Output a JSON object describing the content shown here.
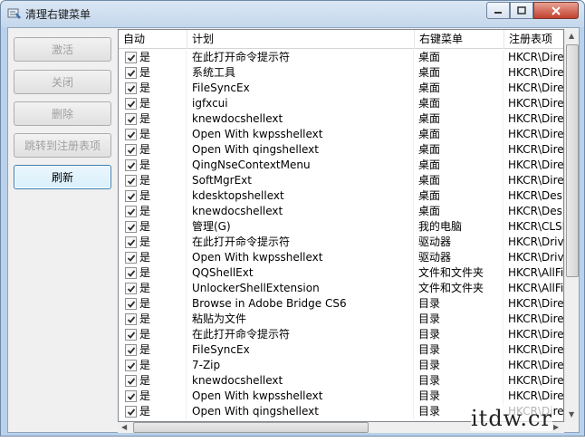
{
  "window": {
    "title": "清理右键菜单"
  },
  "buttons": {
    "activate": "激活",
    "close": "关闭",
    "delete": "删除",
    "jump": "跳转到注册表项",
    "refresh": "刷新"
  },
  "table": {
    "columns": [
      "自动",
      "计划",
      "右键菜单",
      "注册表项"
    ],
    "rows": [
      {
        "auto": "是",
        "plan": "在此打开命令提示符",
        "menu": "桌面",
        "reg": "HKCR\\Directo"
      },
      {
        "auto": "是",
        "plan": "系统工具",
        "menu": "桌面",
        "reg": "HKCR\\Directo"
      },
      {
        "auto": "是",
        "plan": " FileSyncEx",
        "menu": "桌面",
        "reg": "HKCR\\Directo"
      },
      {
        "auto": "是",
        "plan": "igfxcui",
        "menu": "桌面",
        "reg": "HKCR\\Directo"
      },
      {
        "auto": "是",
        "plan": "knewdocshellext",
        "menu": "桌面",
        "reg": "HKCR\\Directo"
      },
      {
        "auto": "是",
        "plan": "Open With kwpsshellext",
        "menu": "桌面",
        "reg": "HKCR\\Directo"
      },
      {
        "auto": "是",
        "plan": "Open With qingshellext",
        "menu": "桌面",
        "reg": "HKCR\\Directo"
      },
      {
        "auto": "是",
        "plan": "QingNseContextMenu",
        "menu": "桌面",
        "reg": "HKCR\\Directo"
      },
      {
        "auto": "是",
        "plan": "SoftMgrExt",
        "menu": "桌面",
        "reg": "HKCR\\Directo"
      },
      {
        "auto": "是",
        "plan": "kdesktopshellext",
        "menu": "桌面",
        "reg": "HKCR\\Deskto"
      },
      {
        "auto": "是",
        "plan": "knewdocshellext",
        "menu": "桌面",
        "reg": "HKCR\\Deskto"
      },
      {
        "auto": "是",
        "plan": "管理(G)",
        "menu": "我的电脑",
        "reg": "HKCR\\CLSID"
      },
      {
        "auto": "是",
        "plan": "在此打开命令提示符",
        "menu": "驱动器",
        "reg": "HKCR\\Drive\\"
      },
      {
        "auto": "是",
        "plan": "Open With kwpsshellext",
        "menu": "驱动器",
        "reg": "HKCR\\Drive\\"
      },
      {
        "auto": "是",
        "plan": "QQShellExt",
        "menu": "文件和文件夹",
        "reg": "HKCR\\AllFiles"
      },
      {
        "auto": "是",
        "plan": "UnlockerShellExtension",
        "menu": "文件和文件夹",
        "reg": "HKCR\\AllFiles"
      },
      {
        "auto": "是",
        "plan": "Browse in Adobe Bridge CS6",
        "menu": "目录",
        "reg": "HKCR\\Directo"
      },
      {
        "auto": "是",
        "plan": "粘贴为文件",
        "menu": "目录",
        "reg": "HKCR\\Directo"
      },
      {
        "auto": "是",
        "plan": "在此打开命令提示符",
        "menu": "目录",
        "reg": "HKCR\\Directo"
      },
      {
        "auto": "是",
        "plan": " FileSyncEx",
        "menu": "目录",
        "reg": "HKCR\\Directo"
      },
      {
        "auto": "是",
        "plan": "7-Zip",
        "menu": "目录",
        "reg": "HKCR\\Directo"
      },
      {
        "auto": "是",
        "plan": "knewdocshellext",
        "menu": "目录",
        "reg": "HKCR\\Directo"
      },
      {
        "auto": "是",
        "plan": "Open With kwpsshellext",
        "menu": "目录",
        "reg": "HKCR\\Directo"
      },
      {
        "auto": "是",
        "plan": "Open With qingshellext",
        "menu": "目录",
        "reg": "HKCR\\Directo"
      }
    ]
  },
  "watermark": "itdw.cr",
  "colors": {
    "titlebar": "#c4d7ec",
    "frame": "#b9d1ea",
    "close_button": "#c2412f"
  },
  "icons": [
    "app-icon",
    "minimize-icon",
    "maximize-icon",
    "close-icon",
    "checkbox-checked-icon"
  ]
}
